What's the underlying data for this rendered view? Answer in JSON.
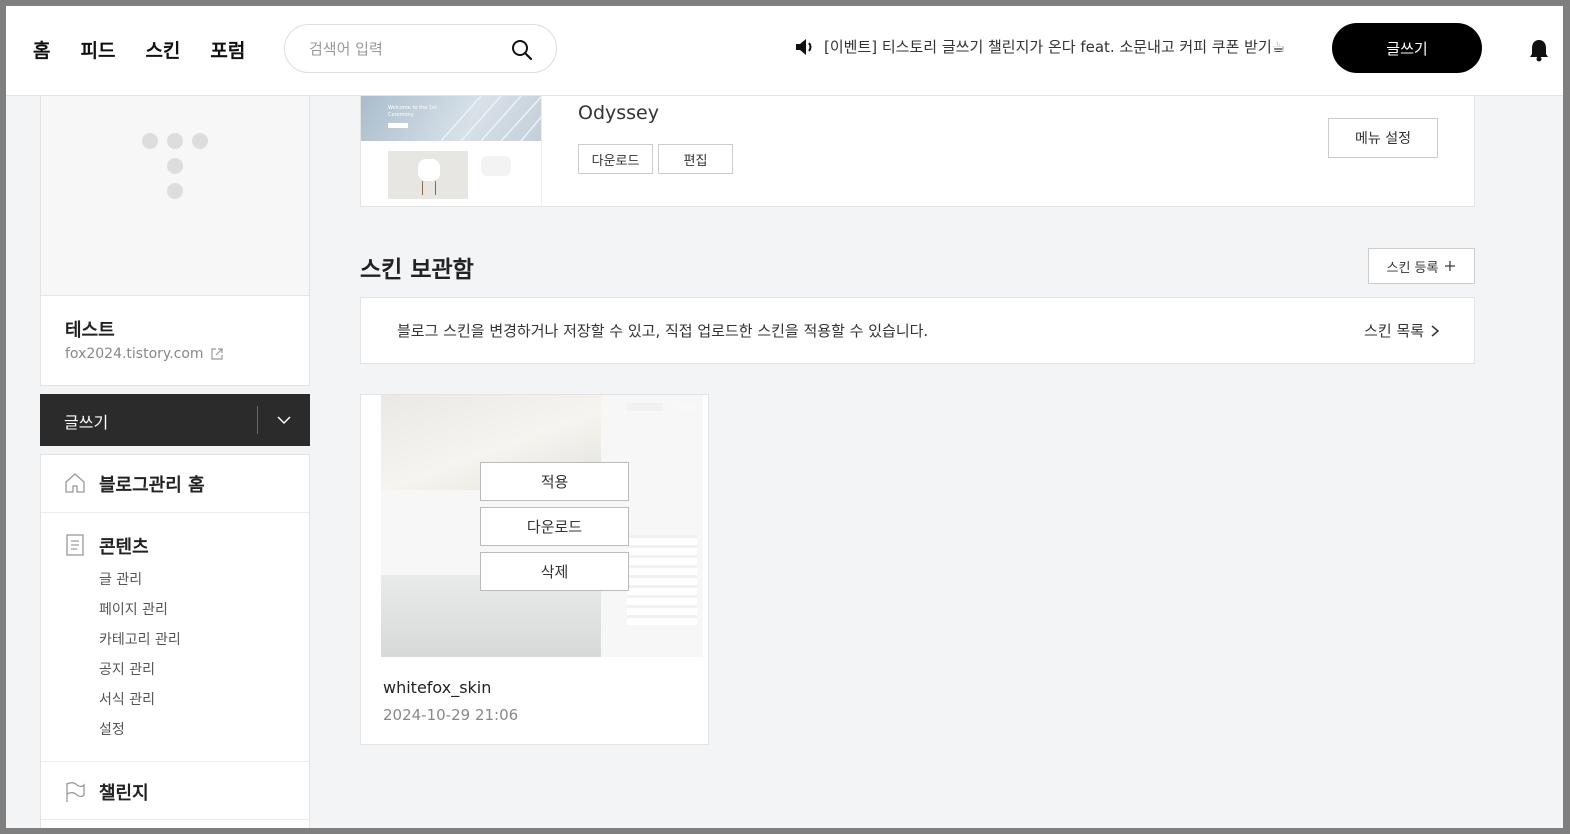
{
  "header": {
    "nav": [
      "홈",
      "피드",
      "스킨",
      "포럼"
    ],
    "search_placeholder": "검색어 입력",
    "notice": "[이벤트] 티스토리 글쓰기 챌린지가 온다 feat. 소문내고 커피 쿠폰 받기☕",
    "write_label": "글쓰기"
  },
  "sidebar": {
    "blog_name": "테스트",
    "blog_url": "fox2024.tistory.com",
    "write_label": "글쓰기",
    "home_label": "블로그관리 홈",
    "content_title": "콘텐츠",
    "content_items": [
      "글 관리",
      "페이지 관리",
      "카테고리 관리",
      "공지 관리",
      "서식 관리",
      "설정"
    ],
    "challenge_label": "챌린지"
  },
  "current_skin": {
    "name": "Odyssey",
    "thumb_title": "Welcome to the 1st Ceremony",
    "download_label": "다운로드",
    "edit_label": "편집",
    "menu_setting_label": "메뉴 설정"
  },
  "storage": {
    "title": "스킨 보관함",
    "register_label": "스킨 등록",
    "info_text": "블로그 스킨을 변경하거나 저장할 수 있고, 직접 업로드한 스킨을 적용할 수 있습니다.",
    "list_link": "스킨 목록",
    "items": [
      {
        "name": "whitefox_skin",
        "date": "2024-10-29 21:06",
        "apply_label": "적용",
        "download_label": "다운로드",
        "delete_label": "삭제"
      }
    ]
  },
  "colors": {
    "dark": "#2b2b2b",
    "background": "#f3f4f6",
    "accent": "#000000"
  }
}
